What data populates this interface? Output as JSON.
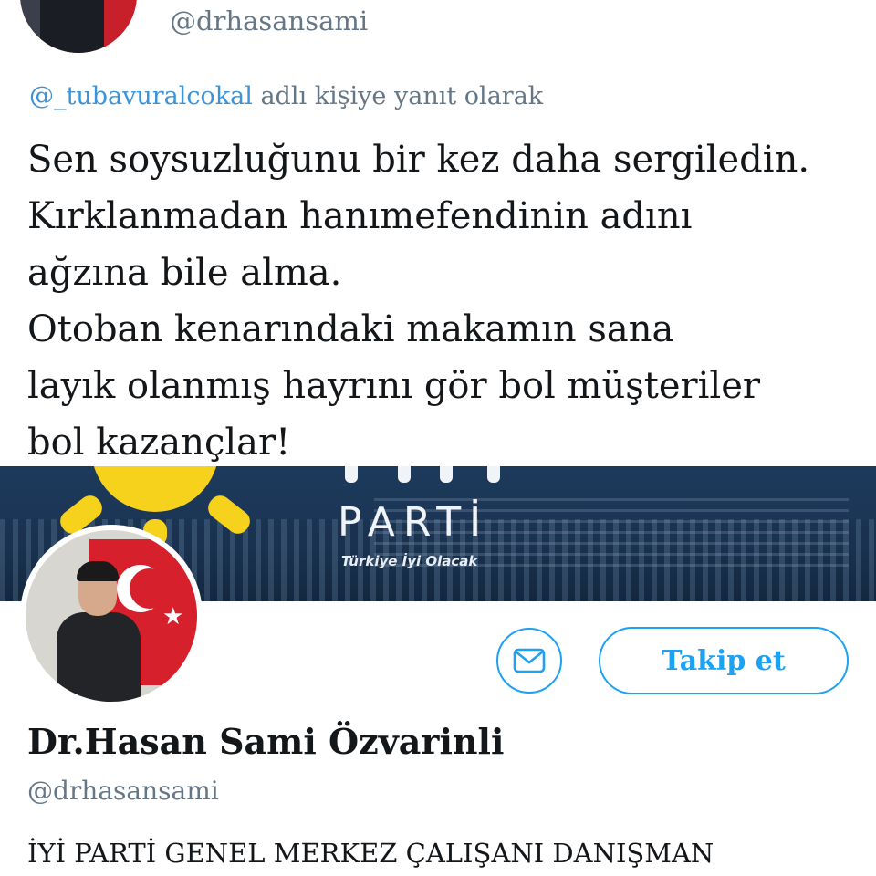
{
  "top_tweet": {
    "handle": "@drhasansami",
    "reply_mention": "@_tubavuralcokal",
    "reply_suffix": " adlı kişiye yanıt olarak",
    "lines": [
      "Sen soysuzluğunu bir kez daha sergiledin.",
      "Kırklanmadan hanımefendinin adını",
      "ağzına bile alma.",
      "Otoban kenarındaki makamın sana",
      "layık olanmış hayrını gör bol müşteriler",
      "bol kazançlar!"
    ]
  },
  "banner": {
    "logo_text": "PARTİ",
    "tagline": "Türkiye İyi Olacak",
    "sun_color": "#f7d21c"
  },
  "profile": {
    "display_name": "Dr.Hasan Sami Özvarinli",
    "handle": "@drhasansami",
    "bio": "İYİ PARTİ GENEL MERKEZ ÇALIŞANI DANIŞMAN",
    "follow_label": "Takip et",
    "message_icon": "envelope-icon",
    "accent_color": "#1da1f2"
  }
}
